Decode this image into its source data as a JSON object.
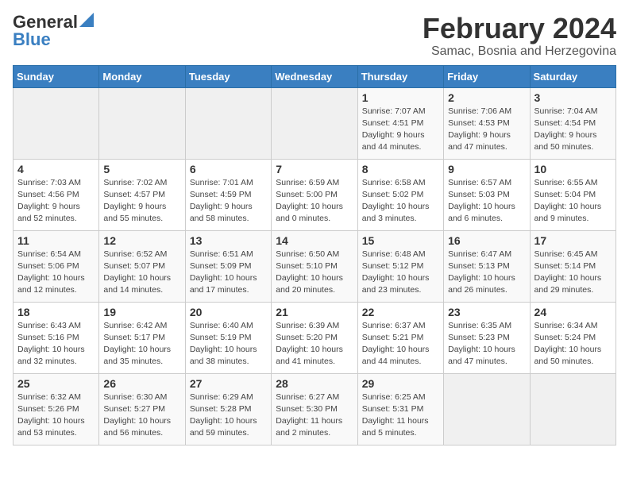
{
  "logo": {
    "general": "General",
    "blue": "Blue"
  },
  "header": {
    "month": "February 2024",
    "location": "Samac, Bosnia and Herzegovina"
  },
  "weekdays": [
    "Sunday",
    "Monday",
    "Tuesday",
    "Wednesday",
    "Thursday",
    "Friday",
    "Saturday"
  ],
  "weeks": [
    [
      {
        "day": "",
        "sunrise": "",
        "sunset": "",
        "daylight": "",
        "empty": true
      },
      {
        "day": "",
        "sunrise": "",
        "sunset": "",
        "daylight": "",
        "empty": true
      },
      {
        "day": "",
        "sunrise": "",
        "sunset": "",
        "daylight": "",
        "empty": true
      },
      {
        "day": "",
        "sunrise": "",
        "sunset": "",
        "daylight": "",
        "empty": true
      },
      {
        "day": "1",
        "sunrise": "Sunrise: 7:07 AM",
        "sunset": "Sunset: 4:51 PM",
        "daylight": "Daylight: 9 hours and 44 minutes.",
        "empty": false
      },
      {
        "day": "2",
        "sunrise": "Sunrise: 7:06 AM",
        "sunset": "Sunset: 4:53 PM",
        "daylight": "Daylight: 9 hours and 47 minutes.",
        "empty": false
      },
      {
        "day": "3",
        "sunrise": "Sunrise: 7:04 AM",
        "sunset": "Sunset: 4:54 PM",
        "daylight": "Daylight: 9 hours and 50 minutes.",
        "empty": false
      }
    ],
    [
      {
        "day": "4",
        "sunrise": "Sunrise: 7:03 AM",
        "sunset": "Sunset: 4:56 PM",
        "daylight": "Daylight: 9 hours and 52 minutes.",
        "empty": false
      },
      {
        "day": "5",
        "sunrise": "Sunrise: 7:02 AM",
        "sunset": "Sunset: 4:57 PM",
        "daylight": "Daylight: 9 hours and 55 minutes.",
        "empty": false
      },
      {
        "day": "6",
        "sunrise": "Sunrise: 7:01 AM",
        "sunset": "Sunset: 4:59 PM",
        "daylight": "Daylight: 9 hours and 58 minutes.",
        "empty": false
      },
      {
        "day": "7",
        "sunrise": "Sunrise: 6:59 AM",
        "sunset": "Sunset: 5:00 PM",
        "daylight": "Daylight: 10 hours and 0 minutes.",
        "empty": false
      },
      {
        "day": "8",
        "sunrise": "Sunrise: 6:58 AM",
        "sunset": "Sunset: 5:02 PM",
        "daylight": "Daylight: 10 hours and 3 minutes.",
        "empty": false
      },
      {
        "day": "9",
        "sunrise": "Sunrise: 6:57 AM",
        "sunset": "Sunset: 5:03 PM",
        "daylight": "Daylight: 10 hours and 6 minutes.",
        "empty": false
      },
      {
        "day": "10",
        "sunrise": "Sunrise: 6:55 AM",
        "sunset": "Sunset: 5:04 PM",
        "daylight": "Daylight: 10 hours and 9 minutes.",
        "empty": false
      }
    ],
    [
      {
        "day": "11",
        "sunrise": "Sunrise: 6:54 AM",
        "sunset": "Sunset: 5:06 PM",
        "daylight": "Daylight: 10 hours and 12 minutes.",
        "empty": false
      },
      {
        "day": "12",
        "sunrise": "Sunrise: 6:52 AM",
        "sunset": "Sunset: 5:07 PM",
        "daylight": "Daylight: 10 hours and 14 minutes.",
        "empty": false
      },
      {
        "day": "13",
        "sunrise": "Sunrise: 6:51 AM",
        "sunset": "Sunset: 5:09 PM",
        "daylight": "Daylight: 10 hours and 17 minutes.",
        "empty": false
      },
      {
        "day": "14",
        "sunrise": "Sunrise: 6:50 AM",
        "sunset": "Sunset: 5:10 PM",
        "daylight": "Daylight: 10 hours and 20 minutes.",
        "empty": false
      },
      {
        "day": "15",
        "sunrise": "Sunrise: 6:48 AM",
        "sunset": "Sunset: 5:12 PM",
        "daylight": "Daylight: 10 hours and 23 minutes.",
        "empty": false
      },
      {
        "day": "16",
        "sunrise": "Sunrise: 6:47 AM",
        "sunset": "Sunset: 5:13 PM",
        "daylight": "Daylight: 10 hours and 26 minutes.",
        "empty": false
      },
      {
        "day": "17",
        "sunrise": "Sunrise: 6:45 AM",
        "sunset": "Sunset: 5:14 PM",
        "daylight": "Daylight: 10 hours and 29 minutes.",
        "empty": false
      }
    ],
    [
      {
        "day": "18",
        "sunrise": "Sunrise: 6:43 AM",
        "sunset": "Sunset: 5:16 PM",
        "daylight": "Daylight: 10 hours and 32 minutes.",
        "empty": false
      },
      {
        "day": "19",
        "sunrise": "Sunrise: 6:42 AM",
        "sunset": "Sunset: 5:17 PM",
        "daylight": "Daylight: 10 hours and 35 minutes.",
        "empty": false
      },
      {
        "day": "20",
        "sunrise": "Sunrise: 6:40 AM",
        "sunset": "Sunset: 5:19 PM",
        "daylight": "Daylight: 10 hours and 38 minutes.",
        "empty": false
      },
      {
        "day": "21",
        "sunrise": "Sunrise: 6:39 AM",
        "sunset": "Sunset: 5:20 PM",
        "daylight": "Daylight: 10 hours and 41 minutes.",
        "empty": false
      },
      {
        "day": "22",
        "sunrise": "Sunrise: 6:37 AM",
        "sunset": "Sunset: 5:21 PM",
        "daylight": "Daylight: 10 hours and 44 minutes.",
        "empty": false
      },
      {
        "day": "23",
        "sunrise": "Sunrise: 6:35 AM",
        "sunset": "Sunset: 5:23 PM",
        "daylight": "Daylight: 10 hours and 47 minutes.",
        "empty": false
      },
      {
        "day": "24",
        "sunrise": "Sunrise: 6:34 AM",
        "sunset": "Sunset: 5:24 PM",
        "daylight": "Daylight: 10 hours and 50 minutes.",
        "empty": false
      }
    ],
    [
      {
        "day": "25",
        "sunrise": "Sunrise: 6:32 AM",
        "sunset": "Sunset: 5:26 PM",
        "daylight": "Daylight: 10 hours and 53 minutes.",
        "empty": false
      },
      {
        "day": "26",
        "sunrise": "Sunrise: 6:30 AM",
        "sunset": "Sunset: 5:27 PM",
        "daylight": "Daylight: 10 hours and 56 minutes.",
        "empty": false
      },
      {
        "day": "27",
        "sunrise": "Sunrise: 6:29 AM",
        "sunset": "Sunset: 5:28 PM",
        "daylight": "Daylight: 10 hours and 59 minutes.",
        "empty": false
      },
      {
        "day": "28",
        "sunrise": "Sunrise: 6:27 AM",
        "sunset": "Sunset: 5:30 PM",
        "daylight": "Daylight: 11 hours and 2 minutes.",
        "empty": false
      },
      {
        "day": "29",
        "sunrise": "Sunrise: 6:25 AM",
        "sunset": "Sunset: 5:31 PM",
        "daylight": "Daylight: 11 hours and 5 minutes.",
        "empty": false
      },
      {
        "day": "",
        "sunrise": "",
        "sunset": "",
        "daylight": "",
        "empty": true
      },
      {
        "day": "",
        "sunrise": "",
        "sunset": "",
        "daylight": "",
        "empty": true
      }
    ]
  ]
}
